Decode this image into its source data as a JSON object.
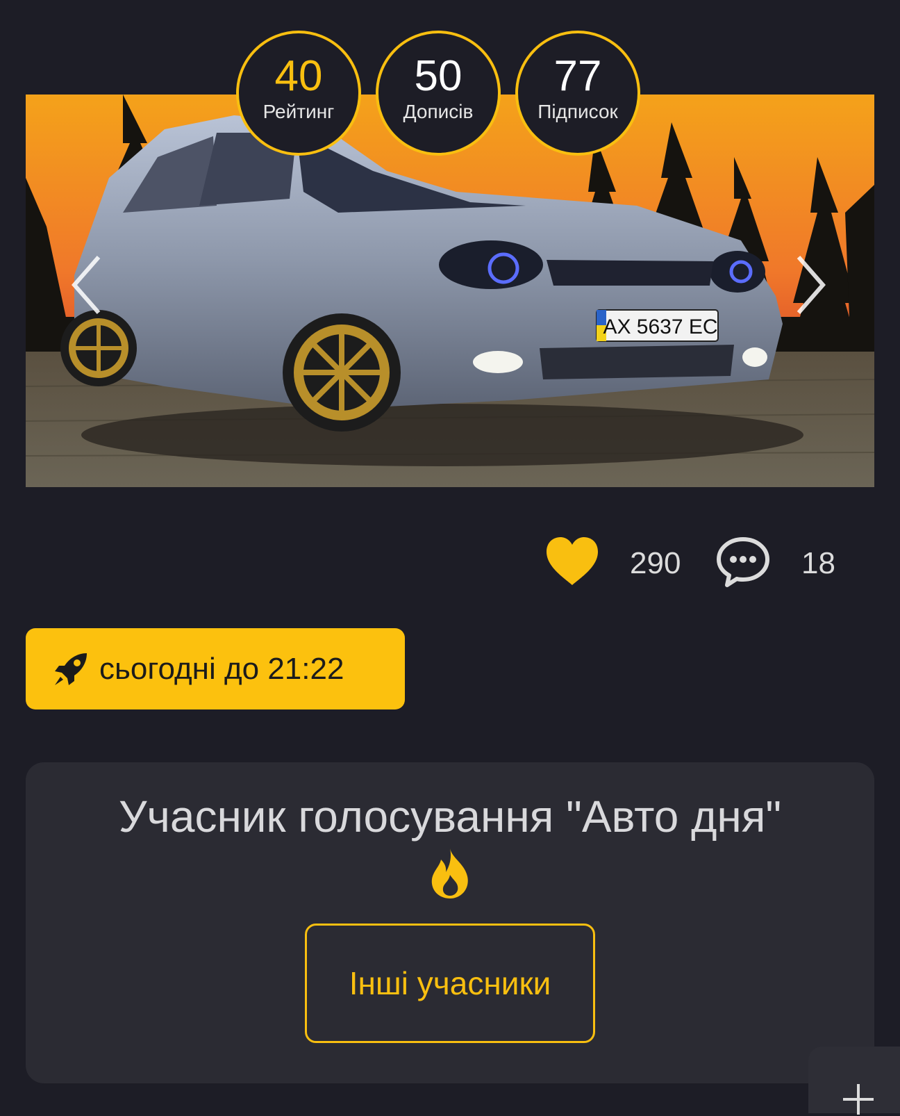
{
  "stats": [
    {
      "value": "40",
      "label": "Рейтинг"
    },
    {
      "value": "50",
      "label": "Дописів"
    },
    {
      "value": "77",
      "label": "Підписок"
    }
  ],
  "photo": {
    "plate": "AX 5637 EC"
  },
  "reactions": {
    "likes": "290",
    "comments": "18"
  },
  "promo": {
    "text": "сьогодні до 21:22"
  },
  "vote": {
    "title": "Учасник голосування \"Авто дня\"",
    "button_label": "Інші учасники"
  },
  "icons": {
    "like": "heart-icon",
    "comments": "comment-bubble-icon",
    "promo": "rocket-icon",
    "vote": "fire-icon",
    "fab": "plus-icon",
    "prev": "chevron-left-icon",
    "next": "chevron-right-icon"
  },
  "colors": {
    "accent": "#f9bf10",
    "background": "#1d1d26",
    "card": "#2b2b33"
  }
}
